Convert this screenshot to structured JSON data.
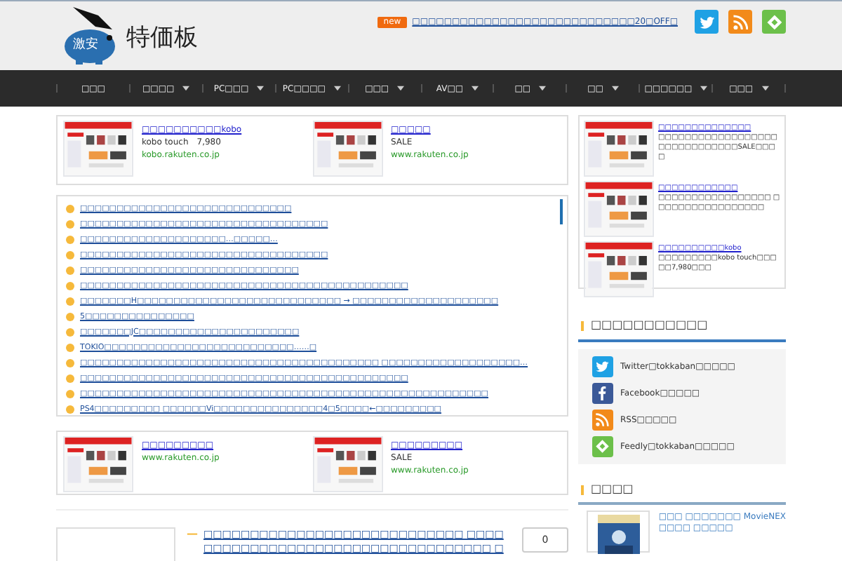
{
  "header": {
    "logo_mark": "激安",
    "site_title": "特価板",
    "ticker": {
      "badge": "new",
      "link": "□□□□□□□□□□□□□□□□□□□□□□□□□□□□20□OFF□"
    }
  },
  "nav": [
    {
      "label": "□□□",
      "dropdown": false
    },
    {
      "label": "□□□□",
      "dropdown": true
    },
    {
      "label": "PC□□□",
      "dropdown": true
    },
    {
      "label": "PC□□□□",
      "dropdown": true
    },
    {
      "label": "□□□",
      "dropdown": true
    },
    {
      "label": "AV□□",
      "dropdown": true
    },
    {
      "label": "□□",
      "dropdown": true
    },
    {
      "label": "□□",
      "dropdown": true
    },
    {
      "label": "□□□□□□",
      "dropdown": true
    },
    {
      "label": "□□□",
      "dropdown": true
    }
  ],
  "ads_top": [
    {
      "title": "□□□□□□□□□□kobo",
      "text": "kobo touch　7,980",
      "url": "kobo.rakuten.co.jp"
    },
    {
      "title": "□□□□□",
      "text": "SALE",
      "url": "www.rakuten.co.jp"
    }
  ],
  "headlines": [
    "□□□□□□□□□□□□□□□□□□□□□□□□□□□□□",
    "□□□□□□□□□□□□□□□□□□□□□□□□□□□□□□□□□□",
    "□□□□□□□□□□□□□□□□□□□□…□□□□□…",
    "□□□□□□□□□□□□□□□□□□□□□□□□□□□□□□□□□□",
    "□□□□□□□□□□□□□□□□□□□□□□□□□□□□□□",
    "□□□□□□□□□□□□□□□□□□□□□□□□□□□□□□□□□□□□□□□□□□□□□",
    "□□□□□□□H□□□□□□□□□□□□□□□□□□□□□□□□□□□□ → □□□□□□□□□□□□□□□□□□□□",
    "5□□□□□□□□□□□□□□□",
    "□□□□□□□JC□□□□□□□□□□□□□□□□□□□□□□",
    "TOKIO□□□□□□□□□□□□□□□□□□□□□□□□□□……□",
    "□□□□□□□□□□□□□□□□□□□□□□□□□□□□□□□□□□□□□□□□□ □□□□□□□□□□□□□□□□□□□…",
    "□□□□□□□□□□□□□□□□□□□□□□□□□□□□□□□□□□□□□□□□□□□□□",
    "□□□□□□□□□□□□□□□□□□□□□□□□□□□□□□□□□□□□□□□□□□□□□□□□□□□□□□□□",
    "PS4□□□□□□□□□ □□□□□□Vi□□□□□□□□□□□□□□□4□5□□□□←□□□□□□□□□"
  ],
  "ads_bottom": [
    {
      "title": "□□□□□□□□□",
      "url": "www.rakuten.co.jp"
    },
    {
      "title": "□□□□□□□□□",
      "text": "SALE",
      "url": "www.rakuten.co.jp"
    }
  ],
  "post": {
    "mark": "—",
    "title": "□□□□□□□□□□□□□□□□□□□□□□□□□□□□ □□□□□□□□□□□□□□□□□□□□□□□□□□□□□□□□□□□ □",
    "comments": "0"
  },
  "sidebar": {
    "ads": [
      {
        "title": "□□□□□□□□□□□□□□",
        "text": "□□□□□□□□□□□□□□□□□□□□□□□□□□□□□□SALE□□□□"
      },
      {
        "title": "□□□□□□□□□□□□",
        "text": "□□□□□□□□□□□□□□□□□ □□□□□□□□□□□□□□□□□"
      },
      {
        "title": "□□□□□□□□□□kobo",
        "text": "□□□□□□□□□kobo touch□□□□□7,980□□□"
      }
    ],
    "follow_heading": "□□□□□□□□□□□",
    "follow": [
      {
        "kind": "twitter",
        "label": "Twitter□tokkaban□□□□□"
      },
      {
        "kind": "facebook",
        "label": "Facebook□□□□□"
      },
      {
        "kind": "rss",
        "label": "RSS□□□□□"
      },
      {
        "kind": "feedly",
        "label": "Feedly□tokkaban□□□□□"
      }
    ],
    "popular_heading": "□□□□",
    "popular": [
      {
        "title": "□□□ □□□□□□□ MovieNEX",
        "line_2": "□□□□ □□□□□"
      }
    ]
  }
}
